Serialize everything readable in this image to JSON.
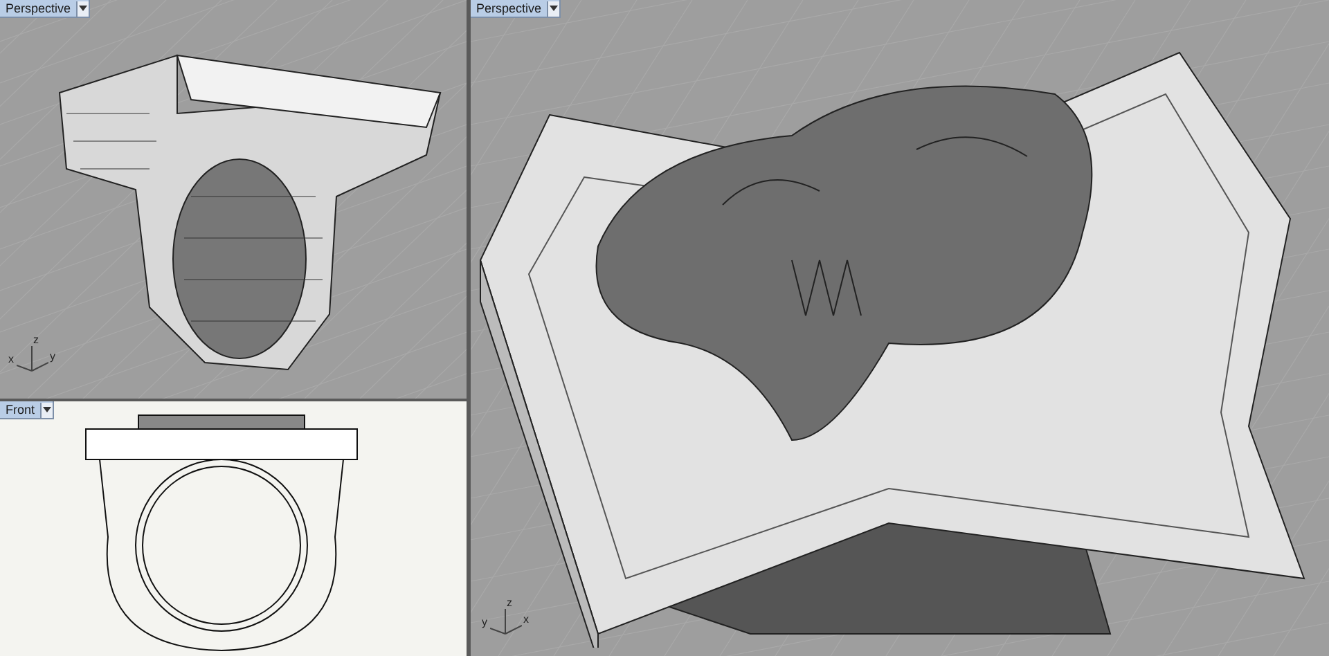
{
  "viewports": [
    {
      "title": "Perspective",
      "kind": "perspective",
      "axes": [
        "z",
        "x",
        "y"
      ]
    },
    {
      "title": "Front",
      "kind": "front"
    },
    {
      "title": "Perspective",
      "kind": "closeup",
      "axes": [
        "z",
        "y",
        "x"
      ]
    }
  ]
}
